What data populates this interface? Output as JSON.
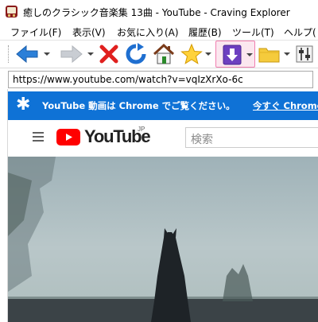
{
  "window": {
    "title": "癒しのクラシック音楽集 13曲 - YouTube - Craving Explorer"
  },
  "menu": {
    "items": [
      {
        "label": "ファイル(F)"
      },
      {
        "label": "表示(V)"
      },
      {
        "label": "お気に入り(A)"
      },
      {
        "label": "履歴(B)"
      },
      {
        "label": "ツール(T)"
      },
      {
        "label": "ヘルプ("
      }
    ]
  },
  "toolbar": {
    "icons": [
      "back-arrow-icon",
      "forward-arrow-icon",
      "stop-icon",
      "refresh-icon",
      "home-icon",
      "favorites-star-icon",
      "download-icon",
      "folder-icon",
      "settings-icon"
    ],
    "download_highlight_color": "#f07fb0"
  },
  "address": {
    "url": "https://www.youtube.com/watch?v=vqIzXrXo-6c"
  },
  "banner": {
    "message": "YouTube 動画は Chrome でご覧ください。",
    "link": "今すぐ Chrome を入",
    "color": "#0f72d6"
  },
  "youtube": {
    "wordmark": "YouTube",
    "region": "JP",
    "search_placeholder": "検索",
    "brand_color": "#ff0000"
  }
}
